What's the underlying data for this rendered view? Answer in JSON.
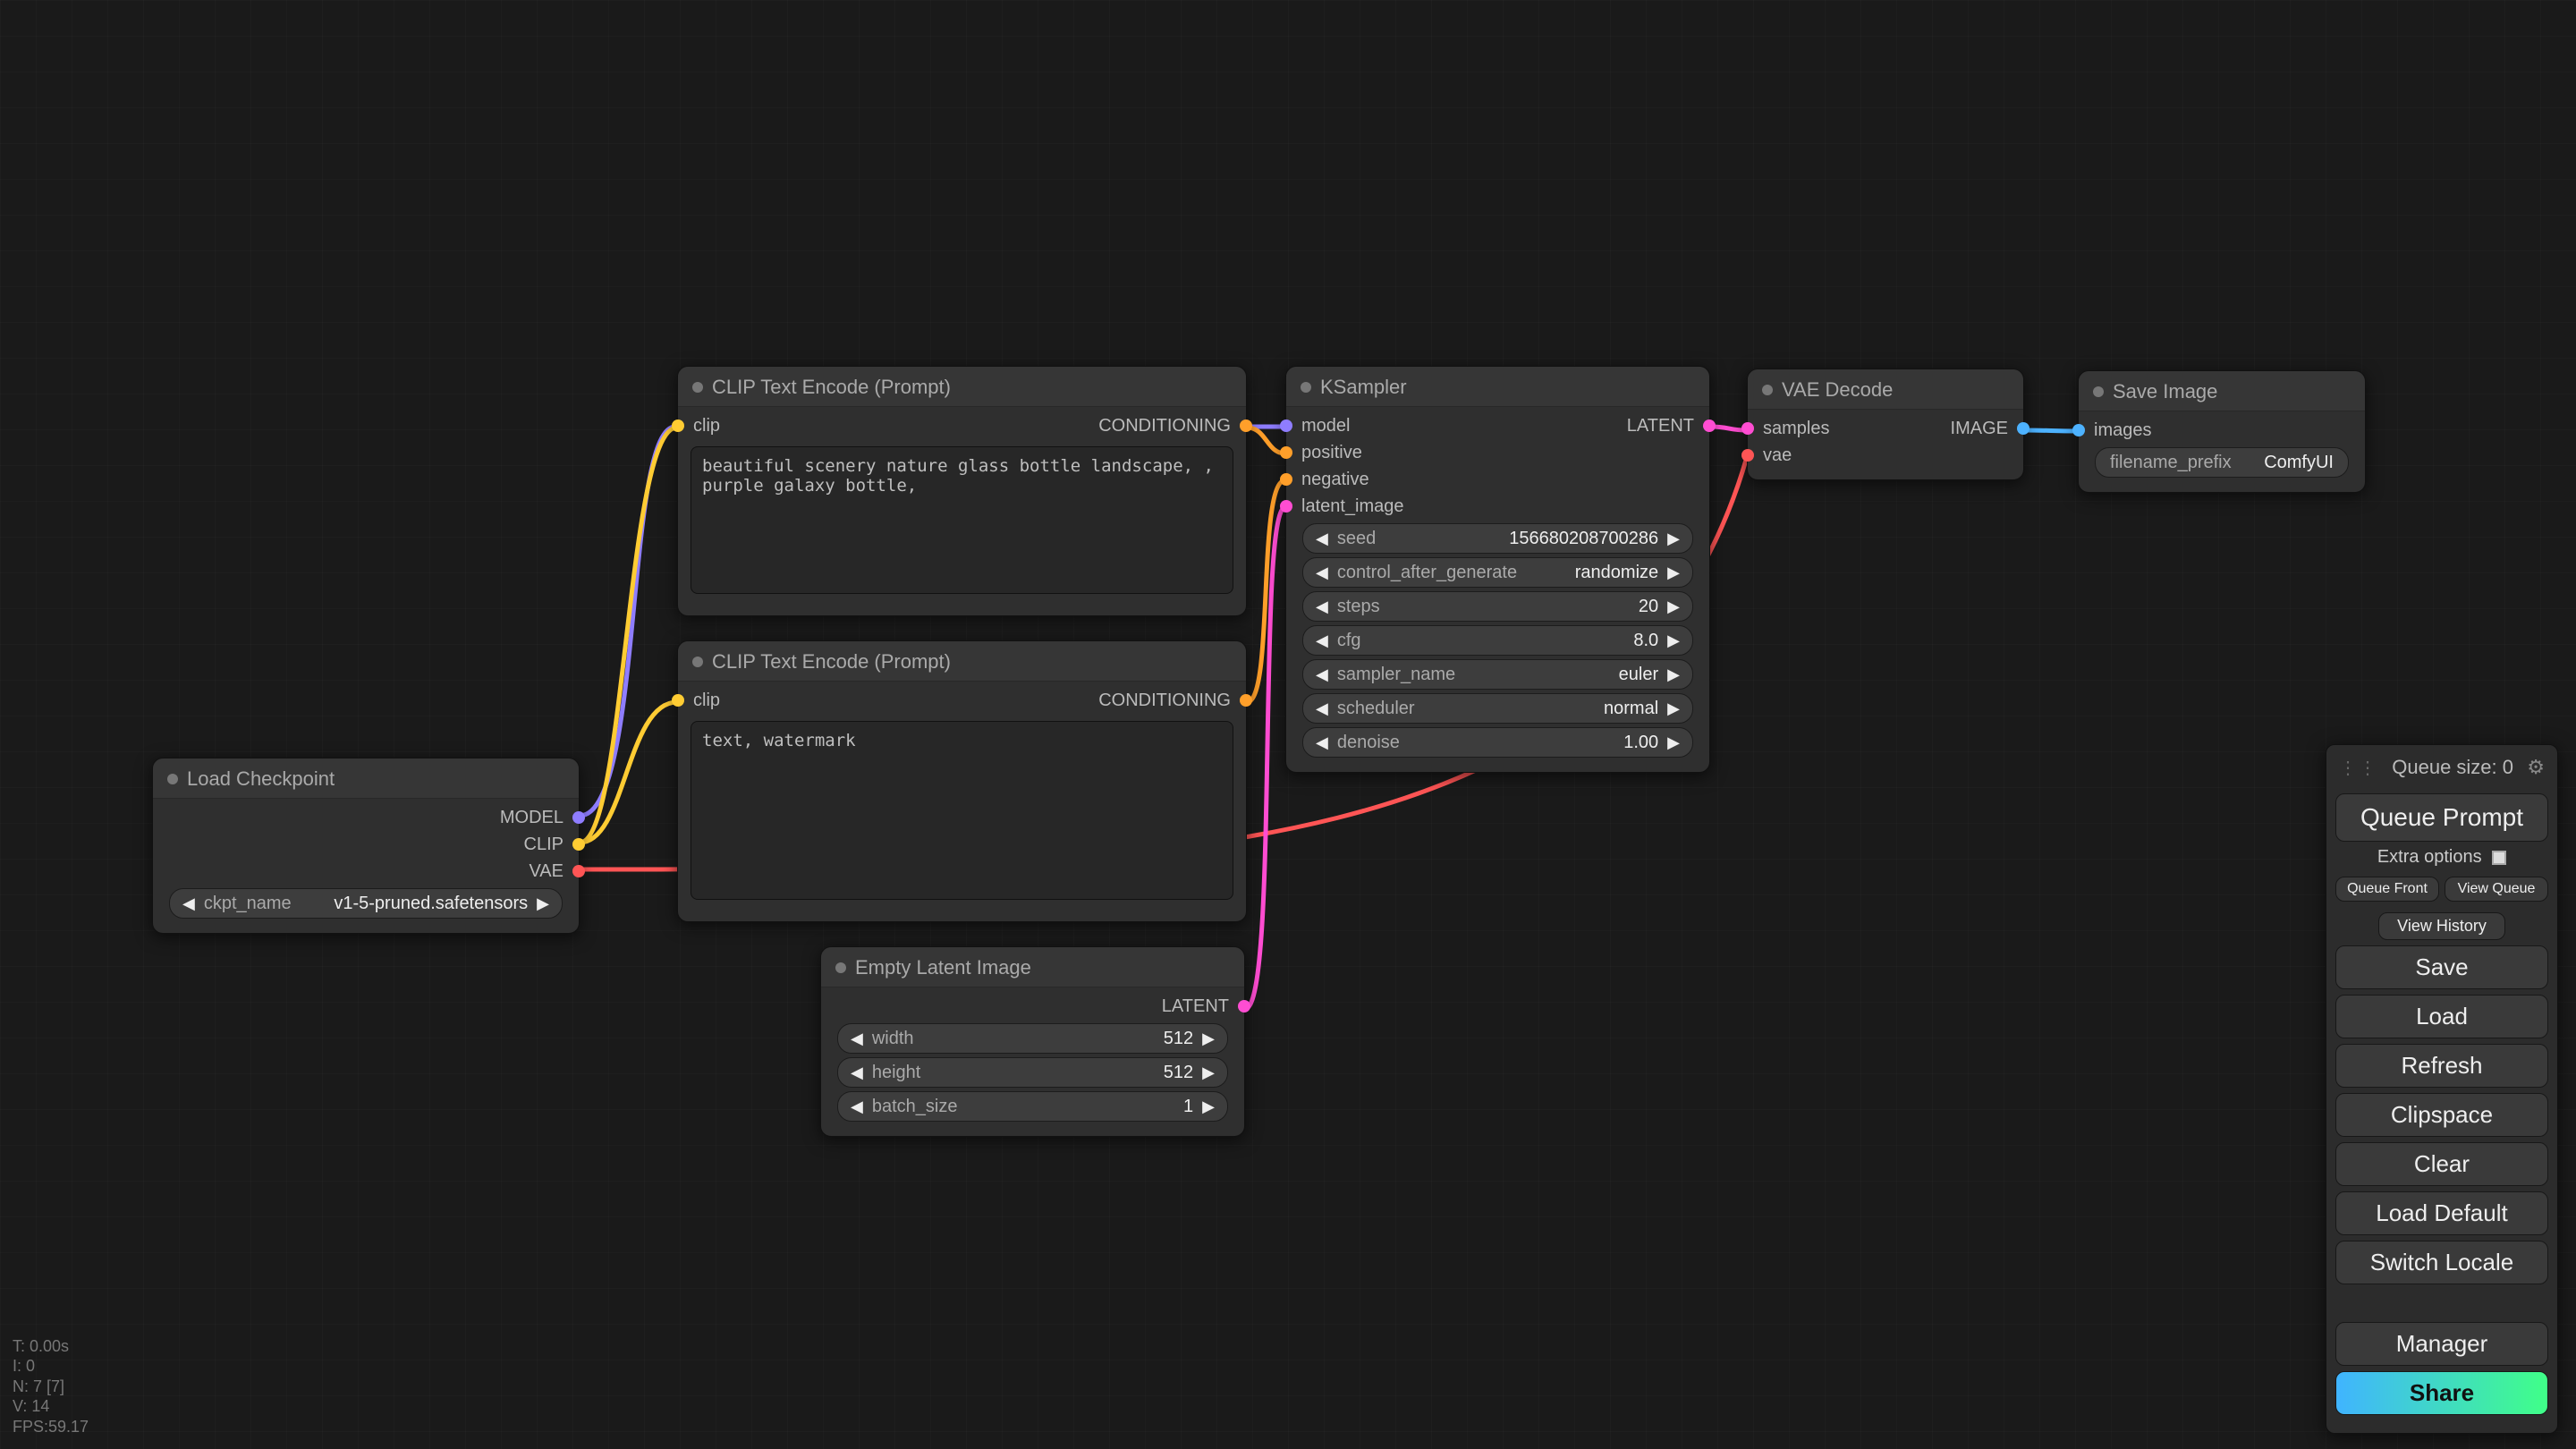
{
  "nodes": {
    "load": {
      "title": "Load Checkpoint",
      "out_model": "MODEL",
      "out_clip": "CLIP",
      "out_vae": "VAE",
      "ckpt_label": "ckpt_name",
      "ckpt_value": "v1-5-pruned.safetensors"
    },
    "clip1": {
      "title": "CLIP Text Encode (Prompt)",
      "in_clip": "clip",
      "out_cond": "CONDITIONING",
      "prompt": "beautiful scenery nature glass bottle landscape, , purple galaxy bottle,"
    },
    "clip2": {
      "title": "CLIP Text Encode (Prompt)",
      "in_clip": "clip",
      "out_cond": "CONDITIONING",
      "prompt": "text, watermark"
    },
    "empty": {
      "title": "Empty Latent Image",
      "out_latent": "LATENT",
      "width_label": "width",
      "width_value": "512",
      "height_label": "height",
      "height_value": "512",
      "batch_label": "batch_size",
      "batch_value": "1"
    },
    "ksampler": {
      "title": "KSampler",
      "in_model": "model",
      "in_pos": "positive",
      "in_neg": "negative",
      "in_latent": "latent_image",
      "out_latent": "LATENT",
      "params": [
        {
          "label": "seed",
          "value": "156680208700286"
        },
        {
          "label": "control_after_generate",
          "value": "randomize"
        },
        {
          "label": "steps",
          "value": "20"
        },
        {
          "label": "cfg",
          "value": "8.0"
        },
        {
          "label": "sampler_name",
          "value": "euler"
        },
        {
          "label": "scheduler",
          "value": "normal"
        },
        {
          "label": "denoise",
          "value": "1.00"
        }
      ]
    },
    "vae": {
      "title": "VAE Decode",
      "in_samples": "samples",
      "in_vae": "vae",
      "out_image": "IMAGE"
    },
    "save": {
      "title": "Save Image",
      "in_images": "images",
      "prefix_label": "filename_prefix",
      "prefix_value": "ComfyUI"
    }
  },
  "panel": {
    "queue_size": "Queue size: 0",
    "queue_prompt": "Queue Prompt",
    "extra_options": "Extra options",
    "queue_front": "Queue Front",
    "view_queue": "View Queue",
    "view_history": "View History",
    "save": "Save",
    "load": "Load",
    "refresh": "Refresh",
    "clipspace": "Clipspace",
    "clear": "Clear",
    "load_default": "Load Default",
    "switch_locale": "Switch Locale",
    "manager": "Manager",
    "share": "Share"
  },
  "stats": "T: 0.00s\nI: 0\nN: 7 [7]\nV: 14\nFPS:59.17"
}
